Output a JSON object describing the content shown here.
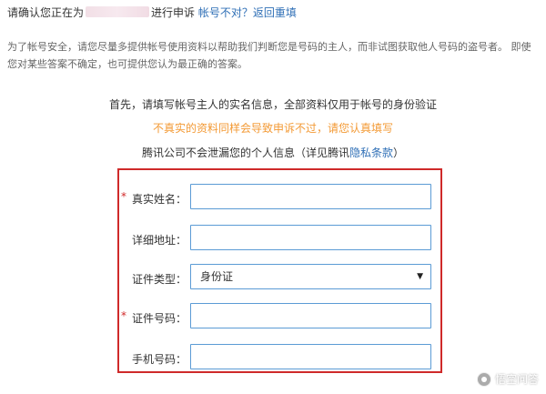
{
  "header": {
    "prefix": "请确认您正在为",
    "suffix": "进行申诉",
    "link_wrong": "帐号不对？",
    "link_back": "返回重填"
  },
  "intro": {
    "text": "为了帐号安全，请您尽量多提供帐号使用资料以帮助我们判断您是号码的主人，而非试图获取他人号码的盗号者。 即使您对某些答案不确定，也可提供您认为最正确的答案。"
  },
  "notices": {
    "line1": "首先，请填写帐号主人的实名信息，全部资料仅用于帐号的身份验证",
    "line2": "不真实的资料同样会导致申诉不过，请您认真填写",
    "line3_text": "腾讯公司不会泄漏您的个人信息（详见腾讯",
    "line3_link": "隐私条款",
    "line3_end": "）"
  },
  "form": {
    "required_mark": "*",
    "fields": [
      {
        "label": "真实姓名：",
        "value": ""
      },
      {
        "label": "详细地址：",
        "value": ""
      },
      {
        "label": "证件类型：",
        "value": "身份证"
      },
      {
        "label": "证件号码：",
        "value": ""
      },
      {
        "label": "手机号码：",
        "value": ""
      }
    ]
  },
  "watermark": {
    "text": "悟空问答"
  }
}
